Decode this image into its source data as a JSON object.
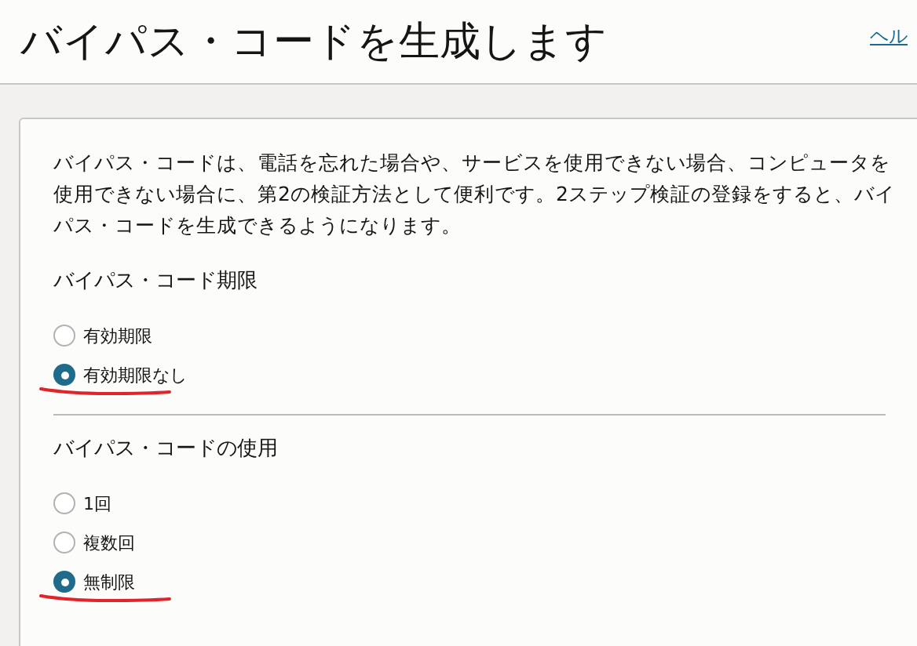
{
  "header": {
    "title": "バイパス・コードを生成します",
    "help_link": "ヘル"
  },
  "description": "バイパス・コードは、電話を忘れた場合や、サービスを使用できない場合、コンピュータを使用できない場合に、第2の検証方法として便利です。2ステップ検証の登録をすると、バイパス・コードを生成できるようになります。",
  "sections": [
    {
      "heading": "バイパス・コード期限",
      "options": [
        {
          "label": "有効期限",
          "selected": false,
          "marked": false
        },
        {
          "label": "有効期限なし",
          "selected": true,
          "marked": true
        }
      ]
    },
    {
      "heading": "バイパス・コードの使用",
      "options": [
        {
          "label": "1回",
          "selected": false,
          "marked": false
        },
        {
          "label": "複数回",
          "selected": false,
          "marked": false
        },
        {
          "label": "無制限",
          "selected": true,
          "marked": true
        }
      ]
    }
  ]
}
